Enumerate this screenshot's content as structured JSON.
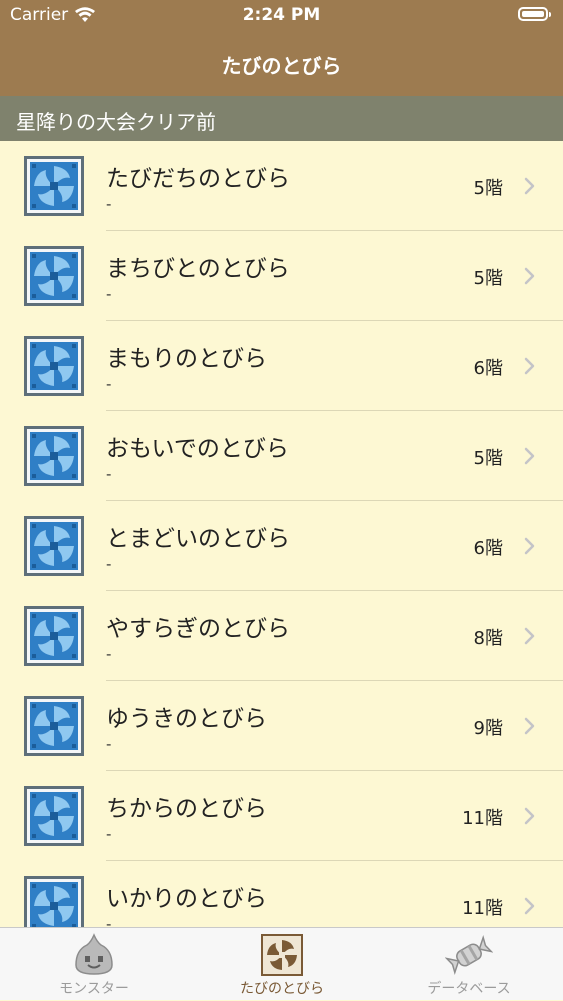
{
  "status": {
    "carrier": "Carrier",
    "time": "2:24 PM"
  },
  "nav": {
    "title": "たびのとびら"
  },
  "section": {
    "title": "星降りの大会クリア前"
  },
  "rows": [
    {
      "name": "たびだちのとびら",
      "sub": "-",
      "floors": "5階"
    },
    {
      "name": "まちびとのとびら",
      "sub": "-",
      "floors": "5階"
    },
    {
      "name": "まもりのとびら",
      "sub": "-",
      "floors": "6階"
    },
    {
      "name": "おもいでのとびら",
      "sub": "-",
      "floors": "5階"
    },
    {
      "name": "とまどいのとびら",
      "sub": "-",
      "floors": "6階"
    },
    {
      "name": "やすらぎのとびら",
      "sub": "-",
      "floors": "8階"
    },
    {
      "name": "ゆうきのとびら",
      "sub": "-",
      "floors": "9階"
    },
    {
      "name": "ちからのとびら",
      "sub": "-",
      "floors": "11階"
    },
    {
      "name": "いかりのとびら",
      "sub": "-",
      "floors": "11階"
    }
  ],
  "tabs": [
    {
      "label": "モンスター",
      "icon": "slime-icon",
      "active": false
    },
    {
      "label": "たびのとびら",
      "icon": "portal-icon",
      "active": true
    },
    {
      "label": "データベース",
      "icon": "candy-icon",
      "active": false
    }
  ],
  "colors": {
    "nav_brown": "#9d7b50",
    "section_gray": "#7f826d",
    "list_background": "#fdf8d3",
    "portal_blue": "#3a8fd6",
    "tab_active": "#7a5a36"
  }
}
